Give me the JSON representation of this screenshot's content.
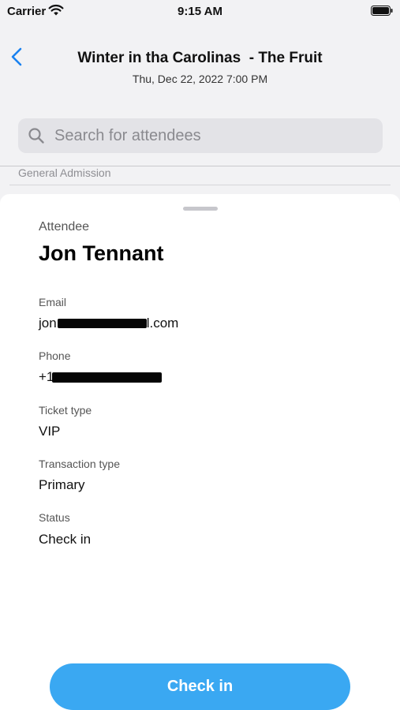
{
  "status_bar": {
    "carrier": "Carrier",
    "time": "9:15 AM"
  },
  "header": {
    "title": "Winter in tha Carolinas  - The Fruit",
    "subtitle": "Thu, Dec 22, 2022 7:00 PM"
  },
  "search": {
    "placeholder": "Search for attendees",
    "value": ""
  },
  "section": {
    "label": "General Admission"
  },
  "attendee": {
    "heading": "Attendee",
    "name": "Jon Tennant",
    "email_label": "Email",
    "email_value_prefix": "jon",
    "email_value_suffix": "l.com",
    "phone_label": "Phone",
    "phone_value_prefix": "+1",
    "ticket_type_label": "Ticket type",
    "ticket_type_value": "VIP",
    "transaction_type_label": "Transaction type",
    "transaction_type_value": "Primary",
    "status_label": "Status",
    "status_value": "Check in"
  },
  "actions": {
    "check_in_label": "Check in"
  },
  "colors": {
    "accent": "#3aa8f2",
    "back_chevron": "#1a82f0"
  }
}
